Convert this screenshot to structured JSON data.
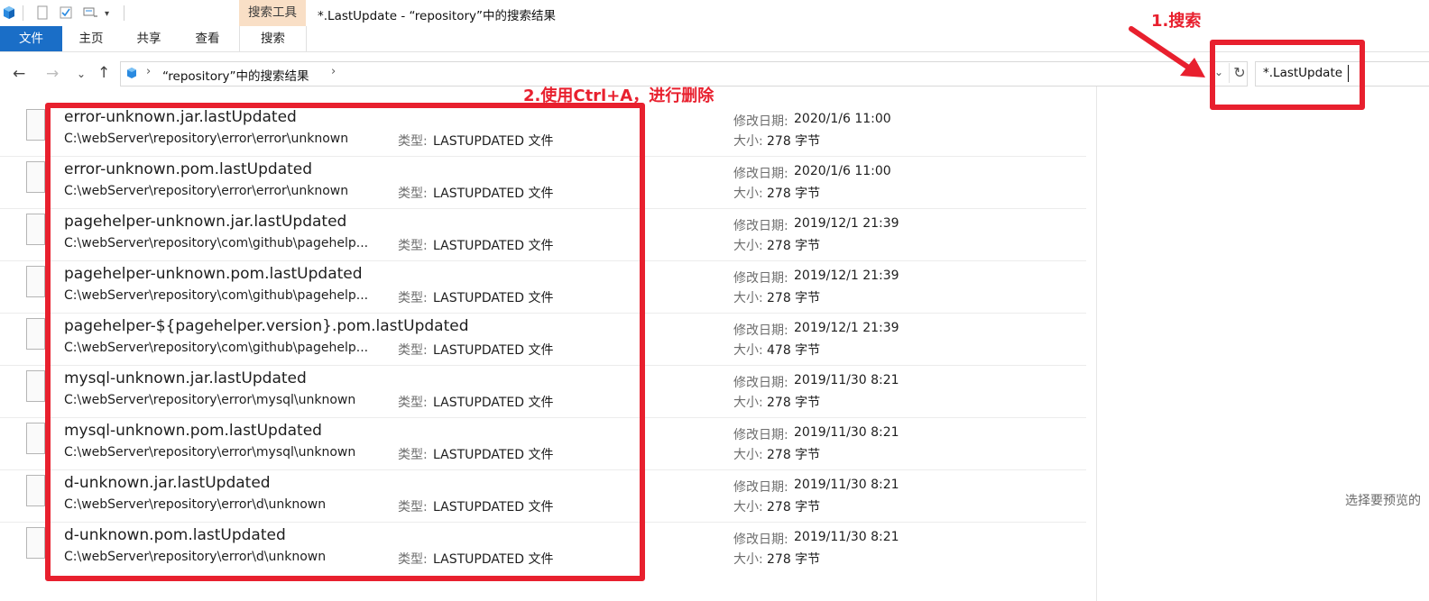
{
  "window": {
    "context_tab": "搜索工具",
    "title": "*.LastUpdate - “repository”中的搜索结果"
  },
  "ribbon_tabs": [
    {
      "label": "文件"
    },
    {
      "label": "主页"
    },
    {
      "label": "共享"
    },
    {
      "label": "查看"
    },
    {
      "label": "搜索"
    }
  ],
  "address": {
    "path": "“repository”中的搜索结果"
  },
  "search": {
    "value": "*.LastUpdate"
  },
  "labels": {
    "type": "类型:",
    "modified": "修改日期:",
    "size": "大小:"
  },
  "files": [
    {
      "name": "error-unknown.jar.lastUpdated",
      "path": "C:\\webServer\\repository\\error\\error\\unknown",
      "type": "LASTUPDATED 文件",
      "date": "2020/1/6 11:00",
      "size": "278 字节"
    },
    {
      "name": "error-unknown.pom.lastUpdated",
      "path": "C:\\webServer\\repository\\error\\error\\unknown",
      "type": "LASTUPDATED 文件",
      "date": "2020/1/6 11:00",
      "size": "278 字节"
    },
    {
      "name": "pagehelper-unknown.jar.lastUpdated",
      "path": "C:\\webServer\\repository\\com\\github\\pagehelp...",
      "type": "LASTUPDATED 文件",
      "date": "2019/12/1 21:39",
      "size": "278 字节"
    },
    {
      "name": "pagehelper-unknown.pom.lastUpdated",
      "path": "C:\\webServer\\repository\\com\\github\\pagehelp...",
      "type": "LASTUPDATED 文件",
      "date": "2019/12/1 21:39",
      "size": "278 字节"
    },
    {
      "name": "pagehelper-${pagehelper.version}.pom.lastUpdated",
      "path": "C:\\webServer\\repository\\com\\github\\pagehelp...",
      "type": "LASTUPDATED 文件",
      "date": "2019/12/1 21:39",
      "size": "478 字节"
    },
    {
      "name": "mysql-unknown.jar.lastUpdated",
      "path": "C:\\webServer\\repository\\error\\mysql\\unknown",
      "type": "LASTUPDATED 文件",
      "date": "2019/11/30 8:21",
      "size": "278 字节"
    },
    {
      "name": "mysql-unknown.pom.lastUpdated",
      "path": "C:\\webServer\\repository\\error\\mysql\\unknown",
      "type": "LASTUPDATED 文件",
      "date": "2019/11/30 8:21",
      "size": "278 字节"
    },
    {
      "name": "d-unknown.jar.lastUpdated",
      "path": "C:\\webServer\\repository\\error\\d\\unknown",
      "type": "LASTUPDATED 文件",
      "date": "2019/11/30 8:21",
      "size": "278 字节"
    },
    {
      "name": "d-unknown.pom.lastUpdated",
      "path": "C:\\webServer\\repository\\error\\d\\unknown",
      "type": "LASTUPDATED 文件",
      "date": "2019/11/30 8:21",
      "size": "278 字节"
    }
  ],
  "preview": {
    "text": "选择要预览的"
  },
  "annotations": {
    "step1": "1.搜索",
    "step2": "2.使用Ctrl+A，进行删除",
    "color": "#e8202e"
  },
  "colors": {
    "file_tab": "#1a6ec7",
    "context_tab": "#f9dfc6"
  },
  "icons": [
    "explorer-cube-icon",
    "properties-icon",
    "checkmark-icon",
    "customize-icon",
    "back-arrow-icon",
    "forward-arrow-icon",
    "recent-dropdown-icon",
    "up-arrow-icon",
    "refresh-icon",
    "file-icon",
    "annotation-arrow-icon"
  ]
}
